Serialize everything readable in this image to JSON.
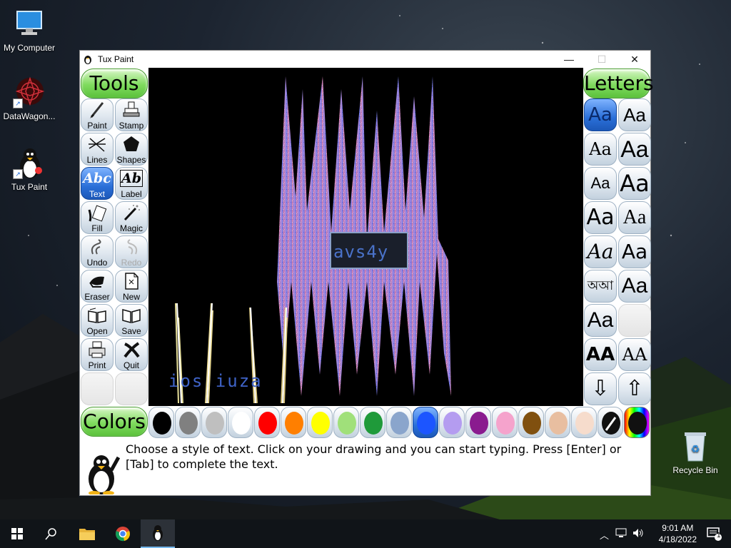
{
  "desktop": {
    "icons": [
      {
        "label": "My Computer"
      },
      {
        "label": "DataWagon..."
      },
      {
        "label": "Tux Paint"
      },
      {
        "label": "Recycle Bin"
      }
    ]
  },
  "window": {
    "title": "Tux Paint",
    "controls": {
      "minimize": "—",
      "maximize": "☐",
      "close": "✕"
    }
  },
  "tools": {
    "header": "Tools",
    "items": [
      {
        "label": "Paint"
      },
      {
        "label": "Stamp"
      },
      {
        "label": "Lines"
      },
      {
        "label": "Shapes"
      },
      {
        "label": "Text"
      },
      {
        "label": "Label"
      },
      {
        "label": "Fill"
      },
      {
        "label": "Magic"
      },
      {
        "label": "Undo"
      },
      {
        "label": "Redo"
      },
      {
        "label": "Eraser"
      },
      {
        "label": "New"
      },
      {
        "label": "Open"
      },
      {
        "label": "Save"
      },
      {
        "label": "Print"
      },
      {
        "label": "Quit"
      }
    ],
    "selected": "Text"
  },
  "letters": {
    "header": "Letters",
    "fonts": [
      "Aa",
      "Aa",
      "Aa",
      "Aa",
      "Aa",
      "Aa",
      "Aa",
      "Aa",
      "Aa",
      "Aa",
      "অআ",
      "Aa",
      "Aa",
      "",
      "AA",
      "AA"
    ],
    "scroll_down": "⇩",
    "scroll_up": "⇧"
  },
  "canvas": {
    "text_entry": "avs4y",
    "drawn_text": "ios  iuza"
  },
  "colors": {
    "header": "Colors",
    "swatches": [
      "#000000",
      "#808080",
      "#bfbfbf",
      "#ffffff",
      "#ff0000",
      "#ff7f00",
      "#ffff00",
      "#a0e07a",
      "#1f9a3a",
      "#8aa5cc",
      "#1c55ff",
      "#b49cf0",
      "#8a1b8f",
      "#f5a3cc",
      "#80500f",
      "#e8bea0",
      "#f6dccc"
    ],
    "selected_index": 10
  },
  "message": "Choose a style of text. Click on your drawing and you can start typing. Press [Enter] or [Tab] to complete the text.",
  "taskbar": {
    "time": "9:01 AM",
    "date": "4/18/2022",
    "notification_count": "1"
  }
}
